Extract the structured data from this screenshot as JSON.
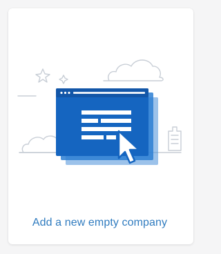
{
  "card": {
    "label": "Add a new empty company",
    "illustration_icon": "company-window-with-cursor-icon",
    "colors": {
      "accent": "#1565c0",
      "accent_light": "#4a90d9",
      "label": "#2f7bbf",
      "line_art": "#c8ced6"
    }
  }
}
